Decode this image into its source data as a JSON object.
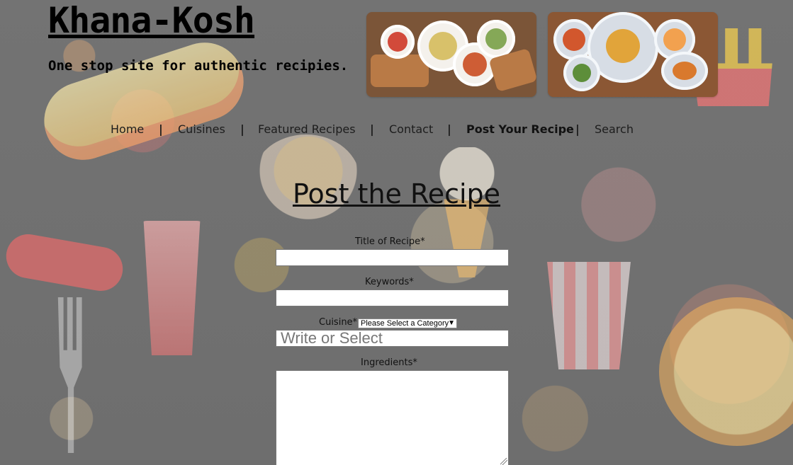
{
  "header": {
    "title": "Khana-Kosh",
    "tagline": "One stop site for authentic recipies."
  },
  "nav": {
    "items": [
      {
        "label": "Home"
      },
      {
        "label": "Cuisines"
      },
      {
        "label": "Featured Recipes"
      },
      {
        "label": "Contact"
      },
      {
        "label": "Post Your Recipe"
      },
      {
        "label": "Search"
      }
    ],
    "separator": "|"
  },
  "form": {
    "heading": "Post the Recipe",
    "title_label": "Title of Recipe*",
    "keywords_label": "Keywords*",
    "cuisine_label": "Cuisine*",
    "cuisine_select_value": "Please Select a Category",
    "cuisine_placeholder": "Write or Select",
    "ingredients_label": "Ingredients*"
  },
  "icons": {
    "select_arrow": "▼"
  }
}
